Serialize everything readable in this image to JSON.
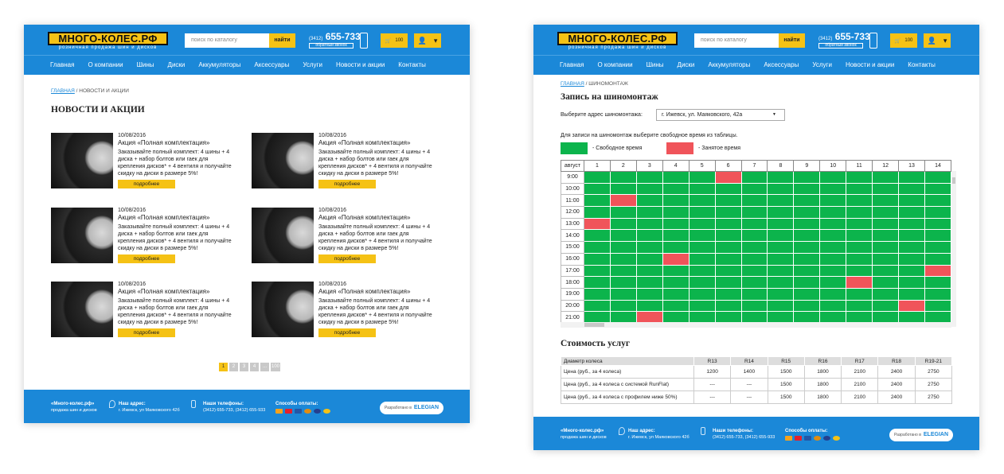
{
  "header": {
    "logo": "МНОГО-КОЛЕС.РФ",
    "tagline": "розничная продажа шин и дисков",
    "search_placeholder": "поиск по каталогу",
    "search_button": "найти",
    "phone_code": "(3412)",
    "phone_number": "655-733",
    "callback": "обратный звонок",
    "cart_count": "100"
  },
  "nav": [
    "Главная",
    "О компании",
    "Шины",
    "Диски",
    "Аккумуляторы",
    "Аксессуары",
    "Услуги",
    "Новости и акции",
    "Контакты"
  ],
  "news_page": {
    "breadcrumb_home": "ГЛАВНАЯ",
    "breadcrumb_sep": "/",
    "breadcrumb_current": "НОВОСТИ И АКЦИИ",
    "title": "НОВОСТИ И АКЦИИ",
    "items": [
      {
        "date": "10/08/2016",
        "title": "Акция «Полная комплектация»",
        "text": "Заказывайте полный комплект: 4 шины + 4 диска + набор болтов или гаек для крепления дисков* + 4 вентиля и получайте скидку на диски в размере 5%!",
        "more": "подробнее"
      },
      {
        "date": "10/08/2016",
        "title": "Акция «Полная комплектация»",
        "text": "Заказывайте полный комплект: 4 шины + 4 диска + набор болтов или гаек для крепления дисков* + 4 вентиля и получайте скидку на диски в размере 5%!",
        "more": "подробнее"
      },
      {
        "date": "10/08/2016",
        "title": "Акция «Полная комплектация»",
        "text": "Заказывайте полный комплект: 4 шины + 4 диска + набор болтов или гаек для крепления дисков* + 4 вентиля и получайте скидку на диски в размере 5%!",
        "more": "подробнее"
      },
      {
        "date": "10/08/2016",
        "title": "Акция «Полная комплектация»",
        "text": "Заказывайте полный комплект: 4 шины + 4 диска + набор болтов или гаек для крепления дисков* + 4 вентиля и получайте скидку на диски в размере 5%!",
        "more": "подробнее"
      },
      {
        "date": "10/08/2016",
        "title": "Акция «Полная комплектация»",
        "text": "Заказывайте полный комплект: 4 шины + 4 диска + набор болтов или гаек для крепления дисков* + 4 вентиля и получайте скидку на диски в размере 5%!",
        "more": "подробнее"
      },
      {
        "date": "10/08/2016",
        "title": "Акция «Полная комплектация»",
        "text": "Заказывайте полный комплект: 4 шины + 4 диска + набор болтов или гаек для крепления дисков* + 4 вентиля и получайте скидку на диски в размере 5%!",
        "more": "подробнее"
      }
    ],
    "pagination": [
      "1",
      "2",
      "3",
      "4",
      "...",
      "100"
    ],
    "pagination_active": 0
  },
  "footer": {
    "brand": "«Много-колес.рф»",
    "brand_sub": "продажа шин и дисков",
    "address_label": "Наш адрес:",
    "address": "г. Ижевск, ул Маяковского 42б",
    "phones_label": "Наши телефоны:",
    "phones": "(3412) 655-733, (3412) 655-933",
    "payment_label": "Способы оплаты:",
    "developer": "Разработано в",
    "developer_name": "ELEGIAN",
    "payment_colors": [
      "#f7a21b",
      "#e4202b",
      "#2456a6",
      "#e08d12",
      "#243f8f",
      "#f5c215"
    ]
  },
  "service_page": {
    "breadcrumb_home": "ГЛАВНАЯ",
    "breadcrumb_sep": "/",
    "breadcrumb_current": "ШИНОМОНТАЖ",
    "title": "Запись на шиномонтаж",
    "address_label": "Выберите адрес шиномонтажа:",
    "address_selected": "г. Ижевск, ул. Маяковского, 42а",
    "instruction": "Для записи на шиномонтаж выберите  свободное время из таблицы.",
    "legend_free": "- Свободное время",
    "legend_busy": "- Занятое время",
    "colors": {
      "free": "#0cb44c",
      "busy": "#f0545a"
    },
    "schedule": {
      "corner": "август",
      "days": [
        "1",
        "2",
        "3",
        "4",
        "5",
        "6",
        "7",
        "8",
        "9",
        "10",
        "11",
        "12",
        "13",
        "14"
      ],
      "times": [
        "9:00",
        "10:00",
        "11:00",
        "12:00",
        "13:00",
        "14:00",
        "15:00",
        "16:00",
        "17:00",
        "18:00",
        "19:00",
        "20:00",
        "21:00"
      ],
      "busy": [
        [
          0,
          5
        ],
        [
          2,
          1
        ],
        [
          4,
          0
        ],
        [
          7,
          3
        ],
        [
          8,
          13
        ],
        [
          9,
          10
        ],
        [
          11,
          12
        ],
        [
          12,
          2
        ]
      ]
    },
    "prices_title": "Стоимость услуг",
    "prices": {
      "headers": [
        "Диаметр колеса",
        "R13",
        "R14",
        "R15",
        "R16",
        "R17",
        "R18",
        "R19-21"
      ],
      "rows": [
        [
          "Цена (руб., за 4 колеса)",
          "1200",
          "1400",
          "1500",
          "1800",
          "2100",
          "2400",
          "2750"
        ],
        [
          "Цена (руб., за 4 колеса с системой RunFlat)",
          "---",
          "---",
          "1500",
          "1800",
          "2100",
          "2400",
          "2750"
        ],
        [
          "Цена (руб., за 4 колеса с профилем ниже 50%)",
          "---",
          "---",
          "1500",
          "1800",
          "2100",
          "2400",
          "2750"
        ]
      ]
    }
  }
}
